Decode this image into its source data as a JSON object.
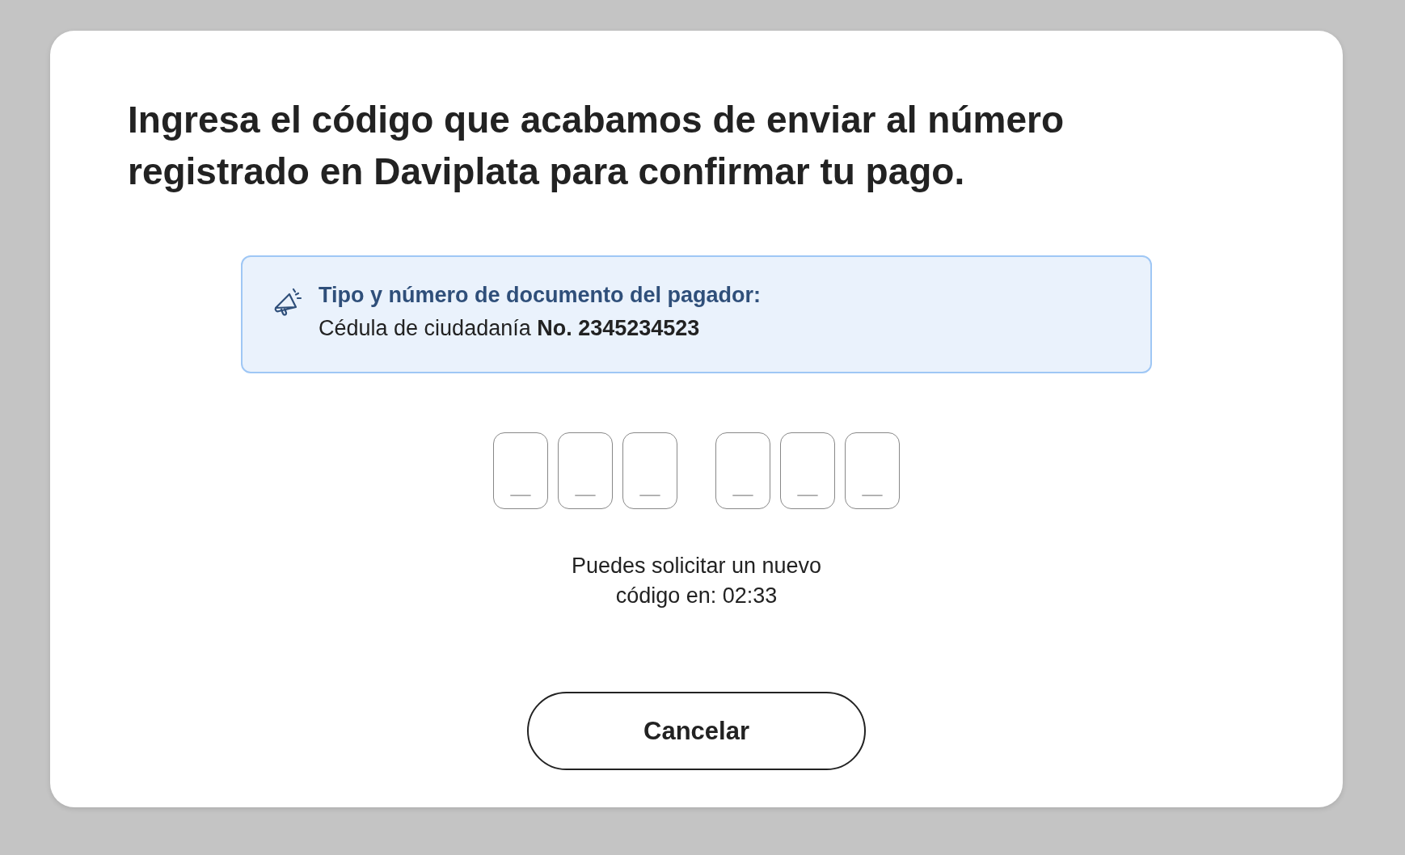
{
  "heading": "Ingresa el código que acabamos de enviar al número registrado en Daviplata para confirmar tu pago.",
  "info": {
    "title": "Tipo y número de documento del pagador:",
    "text": "Cédula de ciudadanía **No. 2345234523**"
  },
  "code_groups": [
    [
      {
        "placeholder": "_"
      },
      {
        "placeholder": "_"
      },
      {
        "placeholder": "_"
      }
    ],
    [
      {
        "placeholder": "_"
      },
      {
        "placeholder": "_"
      },
      {
        "placeholder": "_"
      }
    ]
  ],
  "resend_note": "Puedes solicitar un nuevo código en: 02:33",
  "buttons": [
    {
      "label": "Cancelar"
    }
  ]
}
